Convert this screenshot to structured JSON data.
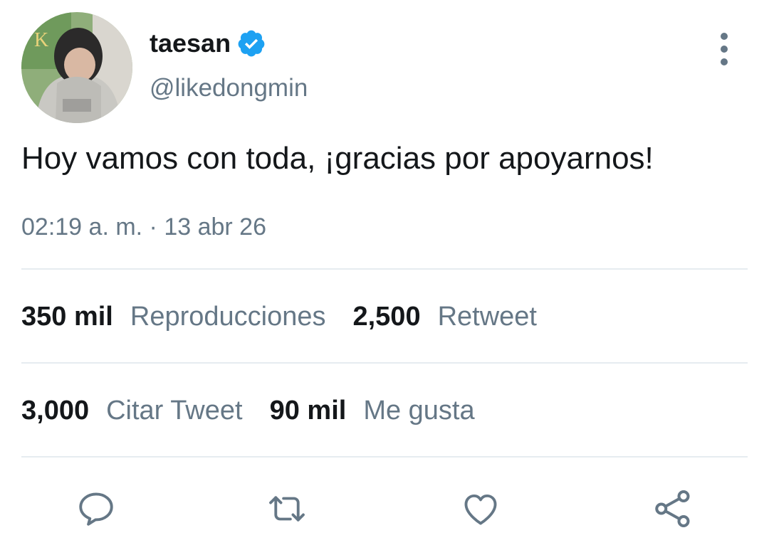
{
  "user": {
    "display_name": "taesan",
    "handle": "@likedongmin",
    "verified_icon": "verified-badge-icon",
    "verified_color": "#1da1f2"
  },
  "tweet": {
    "text": "Hoy vamos con toda, ¡gracias por apoyarnos!",
    "timestamp": "02:19 a. m. · 13 abr 26"
  },
  "stats": {
    "views_count": "350 mil",
    "views_label": "Reproducciones",
    "retweets_count": "2,500",
    "retweets_label": "Retweet",
    "quotes_count": "3,000",
    "quotes_label": "Citar Tweet",
    "likes_count": "90 mil",
    "likes_label": "Me gusta"
  },
  "actions": [
    "reply-icon",
    "retweet-icon",
    "like-icon",
    "share-icon"
  ],
  "colors": {
    "text": "#14171a",
    "muted": "#657786",
    "divider": "#e6ecf0",
    "accent": "#1da1f2"
  }
}
